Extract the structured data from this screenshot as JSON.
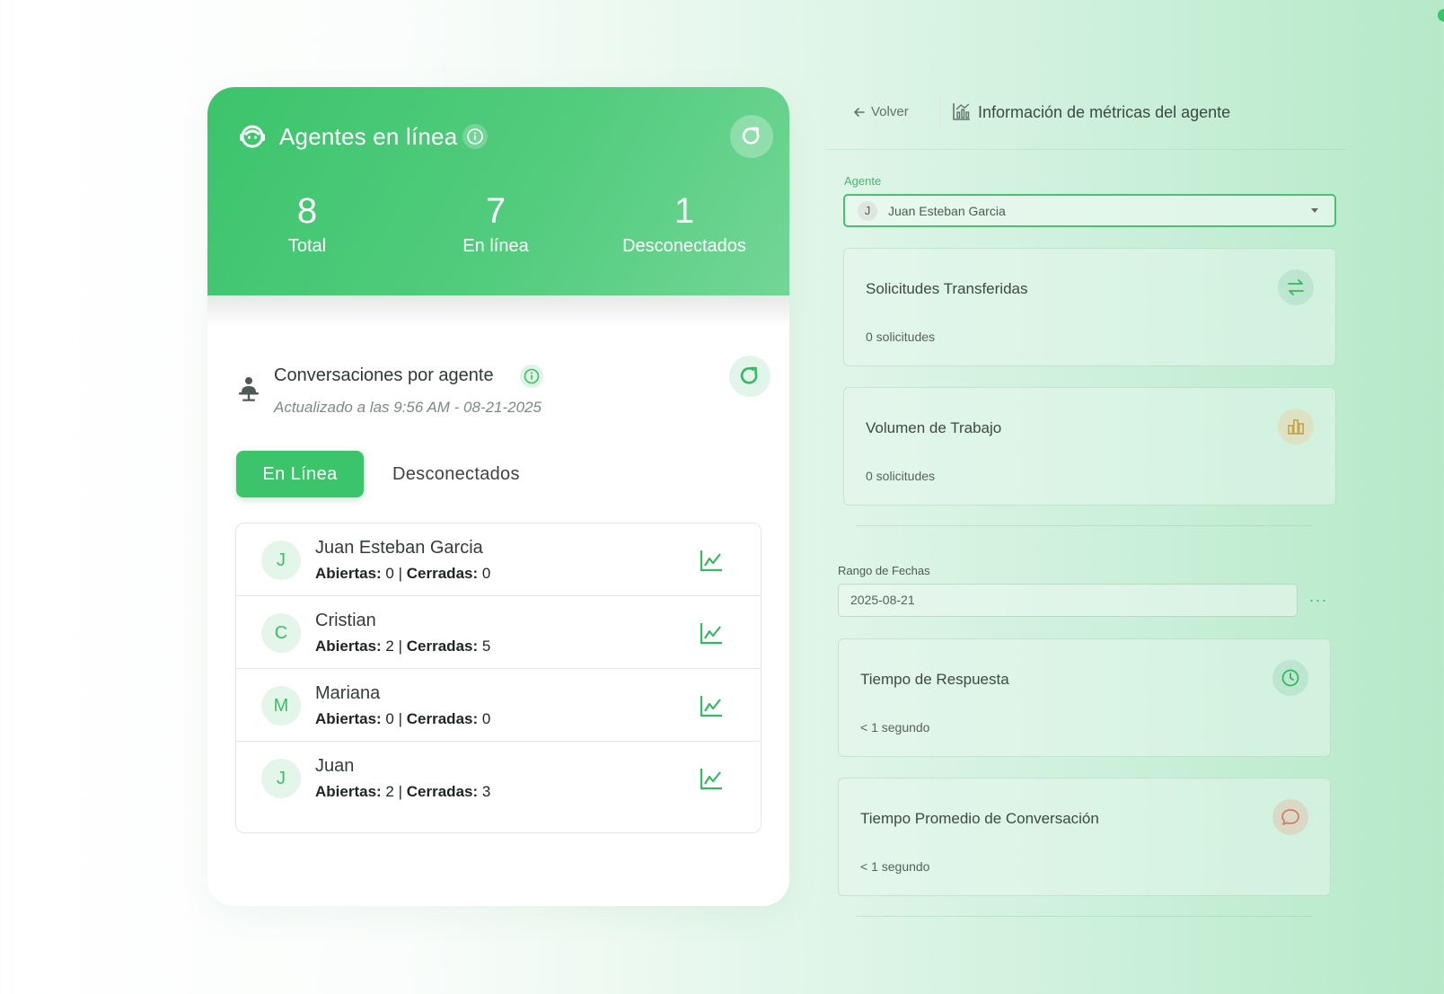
{
  "online_panel": {
    "title": "Agentes en línea",
    "stats": [
      {
        "value": "8",
        "label": "Total"
      },
      {
        "value": "7",
        "label": "En línea"
      },
      {
        "value": "1",
        "label": "Desconectados"
      }
    ]
  },
  "conversations": {
    "title": "Conversaciones por agente",
    "updated": "Actualizado a las 9:56 AM - 08-21-2025",
    "tabs": {
      "active": "En Línea",
      "inactive": "Desconectados"
    },
    "open_label": "Abiertas:",
    "closed_label": "Cerradas:",
    "agents": [
      {
        "initial": "J",
        "name": "Juan Esteban Garcia",
        "open": "0",
        "closed": "0"
      },
      {
        "initial": "C",
        "name": "Cristian",
        "open": "2",
        "closed": "5"
      },
      {
        "initial": "M",
        "name": "Mariana",
        "open": "0",
        "closed": "0"
      },
      {
        "initial": "J",
        "name": "Juan",
        "open": "2",
        "closed": "3"
      }
    ]
  },
  "metrics_panel": {
    "back_label": "Volver",
    "title": "Información de métricas del agente",
    "agent_field": {
      "label": "Agente",
      "initial": "J",
      "value": "Juan Esteban Garcia"
    },
    "cards_top": [
      {
        "title": "Solicitudes Transferidas",
        "value": "0 solicitudes",
        "icon": "transfer-icon"
      },
      {
        "title": "Volumen de Trabajo",
        "value": "0 solicitudes",
        "icon": "bar-chart-icon"
      }
    ],
    "date_range": {
      "label": "Rango de Fechas",
      "value": "2025-08-21",
      "more": "···"
    },
    "cards_bottom": [
      {
        "title": "Tiempo de Respuesta",
        "value": "< 1 segundo",
        "icon": "clock-icon"
      },
      {
        "title": "Tiempo Promedio de Conversación",
        "value": "< 1 segundo",
        "icon": "chat-bubble-icon"
      }
    ]
  },
  "colors": {
    "accent": "#3bc46a",
    "hero_gradient_start": "#3cc46c",
    "hero_gradient_end": "#72d697",
    "icon_amber": "#c9a24a",
    "icon_red": "#d07a6a"
  }
}
